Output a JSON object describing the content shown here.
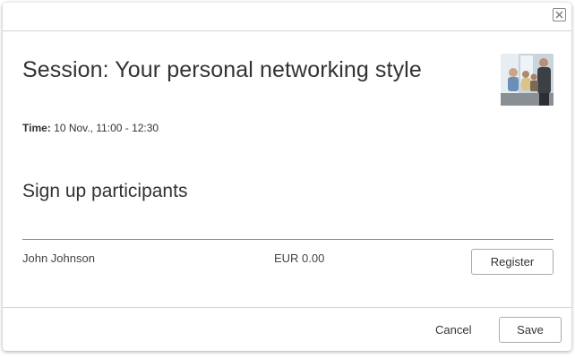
{
  "session": {
    "title": "Session: Your personal networking style",
    "time_label": "Time:",
    "time_value": "10 Nov., 11:00 - 12:30"
  },
  "signup": {
    "heading": "Sign up participants",
    "participants": [
      {
        "name": "John Johnson",
        "price": "EUR 0.00",
        "action_label": "Register"
      }
    ]
  },
  "footer": {
    "cancel_label": "Cancel",
    "save_label": "Save"
  },
  "icons": {
    "close": "close-icon",
    "thumbnail": "session-photo"
  }
}
